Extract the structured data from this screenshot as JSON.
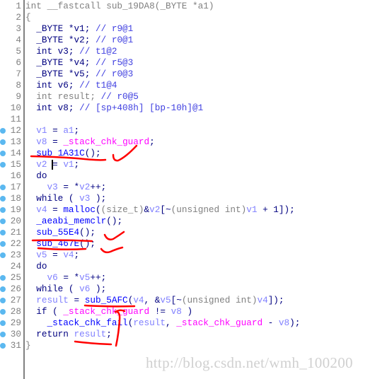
{
  "colors": {
    "keyword": "#000080",
    "gray": "#808080",
    "variable": "#8080ff",
    "comment": "#4040e0",
    "function": "#0000ff",
    "import": "#ff00ff",
    "annotation": "#ff0000",
    "breakpoint_dot": "#5bb8f0"
  },
  "lines": [
    {
      "n": "1",
      "dot": false,
      "t": [
        [
          "int __fastcall sub_19DA8(_BYTE *a1)",
          "g"
        ]
      ]
    },
    {
      "n": "2",
      "dot": false,
      "t": [
        [
          "{",
          "g"
        ]
      ]
    },
    {
      "n": "3",
      "dot": false,
      "t": [
        [
          "  _BYTE *v1; ",
          "k"
        ],
        [
          "// r9@1",
          "c"
        ]
      ]
    },
    {
      "n": "4",
      "dot": false,
      "t": [
        [
          "  _BYTE *v2; ",
          "k"
        ],
        [
          "// r0@1",
          "c"
        ]
      ]
    },
    {
      "n": "5",
      "dot": false,
      "t": [
        [
          "  int v3; ",
          "k"
        ],
        [
          "// t1@2",
          "c"
        ]
      ]
    },
    {
      "n": "6",
      "dot": false,
      "t": [
        [
          "  _BYTE *v4; ",
          "k"
        ],
        [
          "// r5@3",
          "c"
        ]
      ]
    },
    {
      "n": "7",
      "dot": false,
      "t": [
        [
          "  _BYTE *v5; ",
          "k"
        ],
        [
          "// r0@3",
          "c"
        ]
      ]
    },
    {
      "n": "8",
      "dot": false,
      "t": [
        [
          "  int v6; ",
          "k"
        ],
        [
          "// t1@4",
          "c"
        ]
      ]
    },
    {
      "n": "9",
      "dot": false,
      "t": [
        [
          "  int result; ",
          "g"
        ],
        [
          "// r0@5",
          "c"
        ]
      ]
    },
    {
      "n": "10",
      "dot": false,
      "t": [
        [
          "  int v8; ",
          "k"
        ],
        [
          "// [sp+408h] [bp-10h]@1",
          "c"
        ]
      ]
    },
    {
      "n": "11",
      "dot": false,
      "t": []
    },
    {
      "n": "12",
      "dot": true,
      "t": [
        [
          "  ",
          "k"
        ],
        [
          "v1",
          "v"
        ],
        [
          " = ",
          "k"
        ],
        [
          "a1",
          "v"
        ],
        [
          ";",
          "k"
        ]
      ]
    },
    {
      "n": "13",
      "dot": true,
      "t": [
        [
          "  ",
          "k"
        ],
        [
          "v8",
          "v"
        ],
        [
          " = ",
          "k"
        ],
        [
          "_stack_chk_guard",
          "m"
        ],
        [
          ";",
          "k"
        ]
      ]
    },
    {
      "n": "14",
      "dot": true,
      "t": [
        [
          "  ",
          "k"
        ],
        [
          "sub_1A31C",
          "f"
        ],
        [
          "();",
          "k"
        ]
      ]
    },
    {
      "n": "15",
      "dot": true,
      "t": [
        [
          "  ",
          "k"
        ],
        [
          "v2",
          "v"
        ],
        [
          " = ",
          "k"
        ],
        [
          "v1",
          "v"
        ],
        [
          ";",
          "k"
        ]
      ]
    },
    {
      "n": "16",
      "dot": false,
      "t": [
        [
          "  do",
          "k"
        ]
      ]
    },
    {
      "n": "17",
      "dot": true,
      "t": [
        [
          "    ",
          "k"
        ],
        [
          "v3",
          "v"
        ],
        [
          " = *",
          "k"
        ],
        [
          "v2",
          "v"
        ],
        [
          "++;",
          "k"
        ]
      ]
    },
    {
      "n": "18",
      "dot": true,
      "t": [
        [
          "  while ( ",
          "k"
        ],
        [
          "v3",
          "v"
        ],
        [
          " );",
          "k"
        ]
      ]
    },
    {
      "n": "19",
      "dot": true,
      "t": [
        [
          "  ",
          "k"
        ],
        [
          "v4",
          "v"
        ],
        [
          " = ",
          "k"
        ],
        [
          "malloc",
          "f"
        ],
        [
          "(",
          "k"
        ],
        [
          "(size_t)",
          "g"
        ],
        [
          "&",
          "k"
        ],
        [
          "v2",
          "v"
        ],
        [
          "[~",
          "k"
        ],
        [
          "(unsigned int)",
          "g"
        ],
        [
          "v1",
          "v"
        ],
        [
          " + 1]);",
          "k"
        ]
      ]
    },
    {
      "n": "20",
      "dot": true,
      "t": [
        [
          "  ",
          "k"
        ],
        [
          "_aeabi_memclr",
          "f"
        ],
        [
          "();",
          "k"
        ]
      ]
    },
    {
      "n": "21",
      "dot": true,
      "t": [
        [
          "  ",
          "k"
        ],
        [
          "sub_55E4",
          "f"
        ],
        [
          "();",
          "k"
        ]
      ]
    },
    {
      "n": "22",
      "dot": true,
      "t": [
        [
          "  ",
          "k"
        ],
        [
          "sub_467E",
          "f"
        ],
        [
          "();",
          "k"
        ]
      ]
    },
    {
      "n": "23",
      "dot": true,
      "t": [
        [
          "  ",
          "k"
        ],
        [
          "v5",
          "v"
        ],
        [
          " = ",
          "k"
        ],
        [
          "v4",
          "v"
        ],
        [
          ";",
          "k"
        ]
      ]
    },
    {
      "n": "24",
      "dot": false,
      "t": [
        [
          "  do",
          "k"
        ]
      ]
    },
    {
      "n": "25",
      "dot": true,
      "t": [
        [
          "    ",
          "k"
        ],
        [
          "v6",
          "v"
        ],
        [
          " = *",
          "k"
        ],
        [
          "v5",
          "v"
        ],
        [
          "++;",
          "k"
        ]
      ]
    },
    {
      "n": "26",
      "dot": true,
      "t": [
        [
          "  while ( ",
          "k"
        ],
        [
          "v6",
          "v"
        ],
        [
          " );",
          "k"
        ]
      ]
    },
    {
      "n": "27",
      "dot": true,
      "t": [
        [
          "  ",
          "k"
        ],
        [
          "result",
          "v"
        ],
        [
          " = ",
          "k"
        ],
        [
          "sub_5AFC",
          "f"
        ],
        [
          "(",
          "k"
        ],
        [
          "v4",
          "v"
        ],
        [
          ", &",
          "k"
        ],
        [
          "v5",
          "v"
        ],
        [
          "[~",
          "k"
        ],
        [
          "(unsigned int)",
          "g"
        ],
        [
          "v4",
          "v"
        ],
        [
          "]);",
          "k"
        ]
      ]
    },
    {
      "n": "28",
      "dot": true,
      "t": [
        [
          "  if ( ",
          "k"
        ],
        [
          "_stack_chk_guard",
          "m"
        ],
        [
          " != ",
          "k"
        ],
        [
          "v8",
          "v"
        ],
        [
          " )",
          "k"
        ]
      ]
    },
    {
      "n": "29",
      "dot": true,
      "t": [
        [
          "    ",
          "k"
        ],
        [
          "_stack_chk_fail",
          "f"
        ],
        [
          "(",
          "k"
        ],
        [
          "result",
          "v"
        ],
        [
          ", ",
          "k"
        ],
        [
          "_stack_chk_guard",
          "m"
        ],
        [
          " - ",
          "k"
        ],
        [
          "v8",
          "v"
        ],
        [
          ");",
          "k"
        ]
      ]
    },
    {
      "n": "30",
      "dot": true,
      "t": [
        [
          "  return ",
          "k"
        ],
        [
          "result",
          "v"
        ],
        [
          ";",
          "k"
        ]
      ]
    },
    {
      "n": "31",
      "dot": true,
      "t": [
        [
          "}",
          "g"
        ]
      ]
    }
  ],
  "watermark": "http://blog.csdn.net/wmh_100200"
}
